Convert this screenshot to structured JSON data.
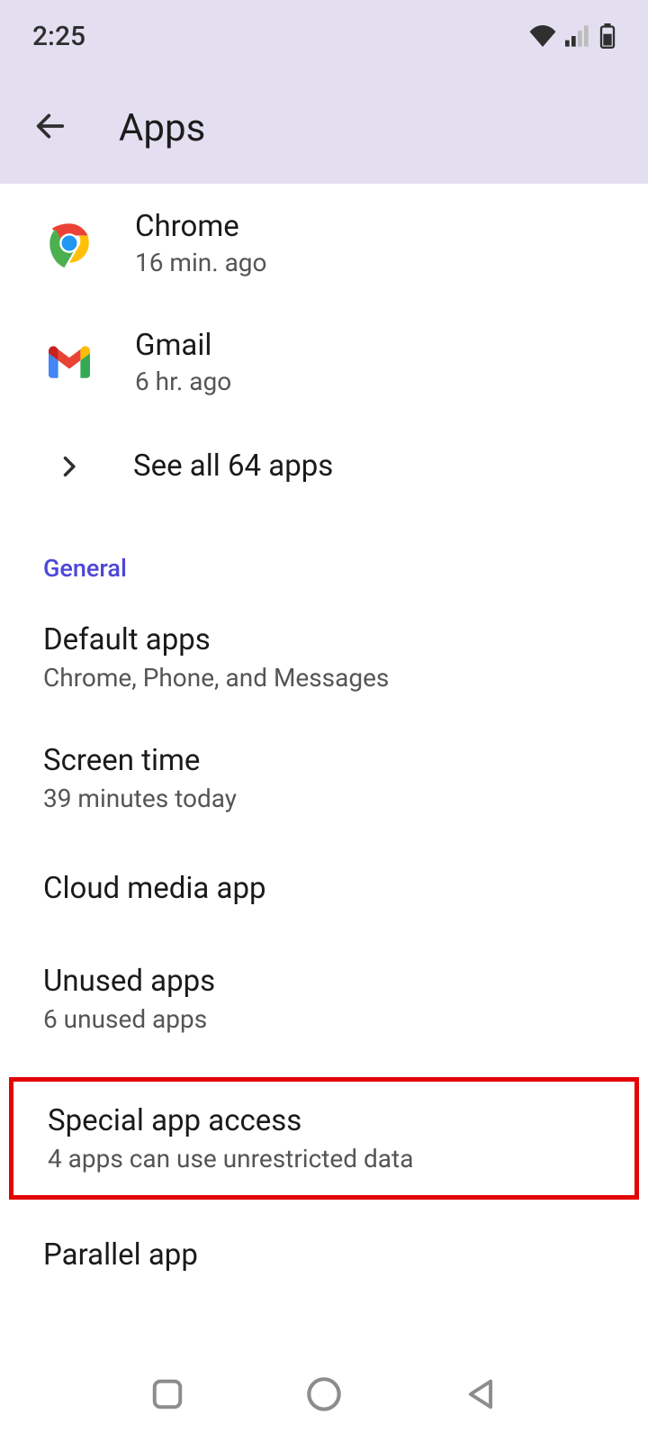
{
  "status": {
    "time": "2:25"
  },
  "header": {
    "title": "Apps"
  },
  "recent": [
    {
      "name": "Chrome",
      "sub": "16 min. ago"
    },
    {
      "name": "Gmail",
      "sub": "6 hr. ago"
    }
  ],
  "see_all": "See all 64 apps",
  "section": "General",
  "settings": {
    "default_apps": {
      "title": "Default apps",
      "sub": "Chrome, Phone, and Messages"
    },
    "screen_time": {
      "title": "Screen time",
      "sub": "39 minutes today"
    },
    "cloud_media": {
      "title": "Cloud media app"
    },
    "unused": {
      "title": "Unused apps",
      "sub": "6 unused apps"
    },
    "special": {
      "title": "Special app access",
      "sub": "4 apps can use unrestricted data"
    },
    "parallel": {
      "title": "Parallel app"
    }
  }
}
